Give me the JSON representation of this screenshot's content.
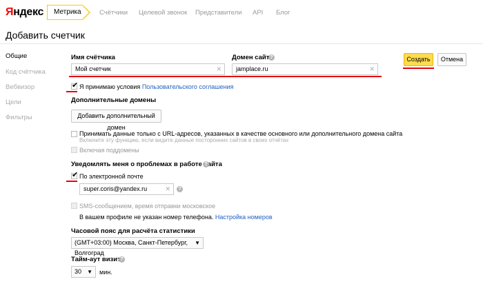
{
  "header": {
    "logo": "Яндекс",
    "tab_metrika": "Метрика",
    "nav": [
      "Счётчики",
      "Целевой звонок",
      "Представители",
      "API",
      "Блог"
    ]
  },
  "page_title": "Добавить счетчик",
  "sidebar": {
    "items": [
      {
        "label": "Общие",
        "active": true
      },
      {
        "label": "Код счётчика",
        "active": false
      },
      {
        "label": "Вебвизор",
        "active": false
      },
      {
        "label": "Цели",
        "active": false
      },
      {
        "label": "Фильтры",
        "active": false
      }
    ]
  },
  "form": {
    "counter_name_label": "Имя счётчика",
    "counter_name_value": "Мой счетчик",
    "domain_label": "Домен сайта",
    "domain_value": "jamplace.ru",
    "accept_text": "Я принимаю условия",
    "accept_link": "Пользовательского соглашения",
    "extra_domains_label": "Дополнительные домены",
    "add_domain_button": "Добавить дополнительный домен",
    "only_urls_text": "Принимать данные только с URL-адресов, указанных в качестве основного или дополнительного домена сайта",
    "only_urls_hint": "Включите эту функцию, если видите данные посторонних сайтов в своих отчётах",
    "subdomains_text": "Включая поддомены",
    "notify_label": "Уведомлять меня о проблемах в работе сайта",
    "email_option": "По электронной почте",
    "email_value": "super.coris@yandex.ru",
    "sms_text": "SMS-сообщением, время отправки московское",
    "phone_missing_text": "В вашем профиле не указан номер телефона.",
    "phone_settings_link": "Настройка номеров",
    "timezone_label": "Часовой пояс для расчёта статистики",
    "timezone_value": "(GMT+03:00) Москва, Санкт-Петербург, Волгоград",
    "timeout_label": "Тайм-аут визита",
    "timeout_value": "30",
    "timeout_unit": "мин."
  },
  "actions": {
    "create": "Создать",
    "cancel": "Отмена"
  },
  "colors": {
    "accent_yellow": "#ffdb4d",
    "annotation_red": "#e4000f",
    "link_blue": "#2060c0"
  }
}
